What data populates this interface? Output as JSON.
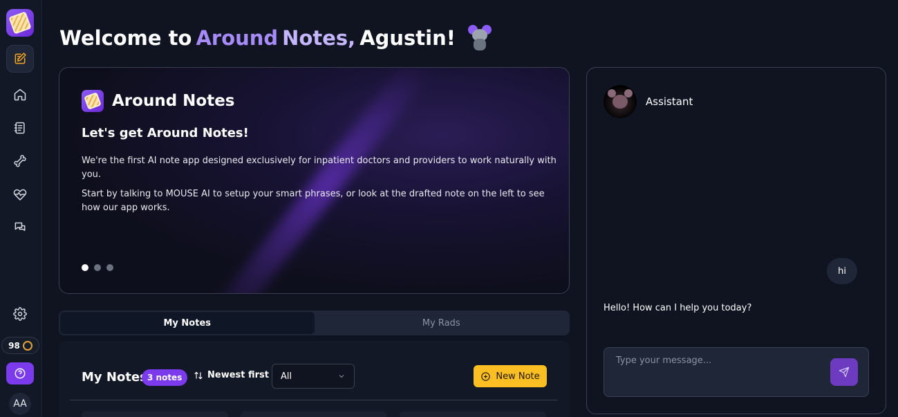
{
  "header": {
    "welcome_prefix": "Welcome to",
    "brand_word1": "Around",
    "brand_word2": "Notes,",
    "user_name": "Agustin!"
  },
  "sidebar": {
    "items": [
      {
        "icon": "edit-note-icon",
        "active": true
      },
      {
        "icon": "home-icon"
      },
      {
        "icon": "notebook-icon"
      },
      {
        "icon": "bone-icon"
      },
      {
        "icon": "heart-pulse-icon"
      },
      {
        "icon": "chat-icon"
      },
      {
        "icon": "gear-icon"
      }
    ],
    "credits": "98",
    "avatar_initials": "AA"
  },
  "hero": {
    "title": "Around Notes",
    "subtitle": "Let's get Around Notes!",
    "paragraph1": "We're the first AI note app designed exclusively for inpatient doctors and providers to work naturally with you.",
    "paragraph2": "Start by talking to MOUSE AI to setup your smart phrases, or look at the drafted note on the left to see how our app works.",
    "carousel_dots": 3,
    "active_dot": 0
  },
  "tabs": {
    "my_notes": "My Notes",
    "my_rads": "My Rads"
  },
  "notes": {
    "title": "My Notes",
    "count_badge": "3 notes",
    "sort_label": "Newest first",
    "filter_value": "All",
    "new_note_label": "New Note"
  },
  "assistant": {
    "name": "Assistant",
    "messages": [
      {
        "role": "user",
        "text": "hi"
      },
      {
        "role": "assistant",
        "text": "Hello! How can I help you today?"
      }
    ],
    "input_placeholder": "Type your message..."
  },
  "colors": {
    "accent_purple": "#7c3aed",
    "accent_yellow": "#fbbf24",
    "background": "#0f1420"
  }
}
